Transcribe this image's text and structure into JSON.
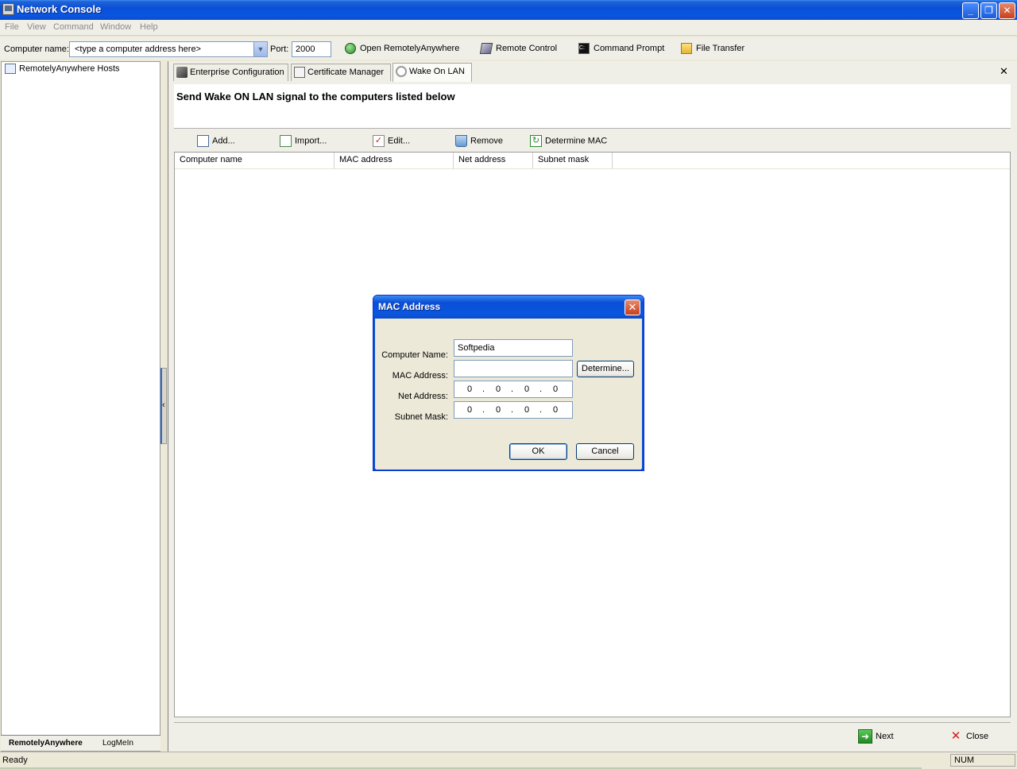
{
  "window": {
    "title": "Network Console"
  },
  "menu": [
    "File",
    "View",
    "Command",
    "Window",
    "Help"
  ],
  "toolbar": {
    "computer_label": "Computer name:",
    "computer_value": "<type a computer address here>",
    "port_label": "Port:",
    "port_value": "2000",
    "buttons": [
      "Open RemotelyAnywhere",
      "Remote Control",
      "Command Prompt",
      "File Transfer"
    ]
  },
  "tree": {
    "root": "RemotelyAnywhere Hosts"
  },
  "bottom_tabs": [
    "RemotelyAnywhere",
    "LogMeIn"
  ],
  "tabs": [
    "Enterprise Configuration",
    "Certificate Manager",
    "Wake On LAN"
  ],
  "main": {
    "heading": "Send Wake ON LAN signal to the computers listed below",
    "tools": [
      "Add...",
      "Import...",
      "Edit...",
      "Remove",
      "Determine MAC"
    ],
    "columns": [
      "Computer name",
      "MAC address",
      "Net address",
      "Subnet mask"
    ],
    "footer": {
      "next": "Next",
      "close": "Close"
    }
  },
  "dialog": {
    "title": "MAC Address",
    "fields": {
      "computer_name_label": "Computer Name:",
      "computer_name_value": "Softpedia",
      "mac_label": "MAC Address:",
      "mac_value": "",
      "net_label": "Net Address:",
      "net_octets": [
        "0",
        "0",
        "0",
        "0"
      ],
      "subnet_label": "Subnet Mask:",
      "subnet_octets": [
        "0",
        "0",
        "0",
        "0"
      ]
    },
    "determine": "Determine...",
    "ok": "OK",
    "cancel": "Cancel"
  },
  "status": {
    "text": "Ready",
    "num": "NUM"
  }
}
